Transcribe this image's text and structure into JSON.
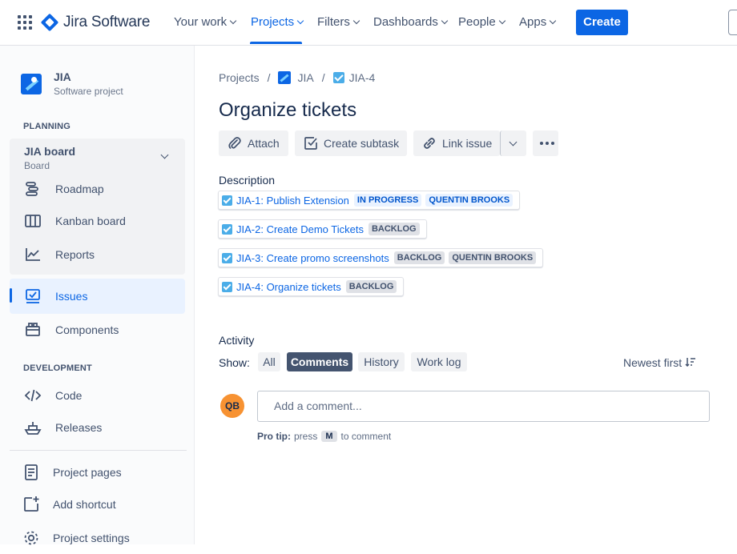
{
  "topnav": {
    "logo_text": "Jira Software",
    "items": [
      {
        "label": "Your work"
      },
      {
        "label": "Projects"
      },
      {
        "label": "Filters"
      },
      {
        "label": "Dashboards"
      },
      {
        "label": "People"
      },
      {
        "label": "Apps"
      }
    ],
    "active_item": "Projects",
    "create_label": "Create"
  },
  "sidebar": {
    "project_name": "JIA",
    "project_type": "Software project",
    "planning_label": "PLANNING",
    "board": {
      "title": "JIA board",
      "subtitle": "Board"
    },
    "planning_items": [
      {
        "label": "Roadmap",
        "icon": "roadmap-icon"
      },
      {
        "label": "Kanban board",
        "icon": "kanban-icon"
      },
      {
        "label": "Reports",
        "icon": "reports-icon"
      }
    ],
    "issues_label": "Issues",
    "components_label": "Components",
    "development_label": "DEVELOPMENT",
    "code_label": "Code",
    "releases_label": "Releases",
    "project_pages_label": "Project pages",
    "add_shortcut_label": "Add shortcut",
    "project_settings_label": "Project settings"
  },
  "breadcrumb": {
    "projects": "Projects",
    "project": "JIA",
    "issue": "JIA-4"
  },
  "issue": {
    "title": "Organize tickets",
    "toolbar": {
      "attach": "Attach",
      "create_subtask": "Create subtask",
      "link_issue": "Link issue"
    },
    "description_label": "Description",
    "linked_issues": [
      {
        "text": "JIA-1: Publish Extension",
        "status": "IN PROGRESS",
        "assignee": "QUENTIN BROOKS"
      },
      {
        "text": "JIA-2: Create Demo Tickets",
        "status": "BACKLOG"
      },
      {
        "text": "JIA-3: Create promo screenshots",
        "status": "BACKLOG",
        "assignee": "QUENTIN BROOKS"
      },
      {
        "text": "JIA-4: Organize tickets",
        "status": "BACKLOG"
      }
    ]
  },
  "activity": {
    "label": "Activity",
    "show_label": "Show:",
    "filters": [
      "All",
      "Comments",
      "History",
      "Work log"
    ],
    "active_filter": "Comments",
    "sort_label": "Newest first",
    "avatar_initials": "QB",
    "comment_placeholder": "Add a comment...",
    "protip_bold": "Pro tip:",
    "protip_pre": "press",
    "protip_key": "M",
    "protip_post": "to comment"
  },
  "colors": {
    "accent": "#0c66e4",
    "avatar": "#f79232",
    "active_filter_bg": "#44546f"
  }
}
